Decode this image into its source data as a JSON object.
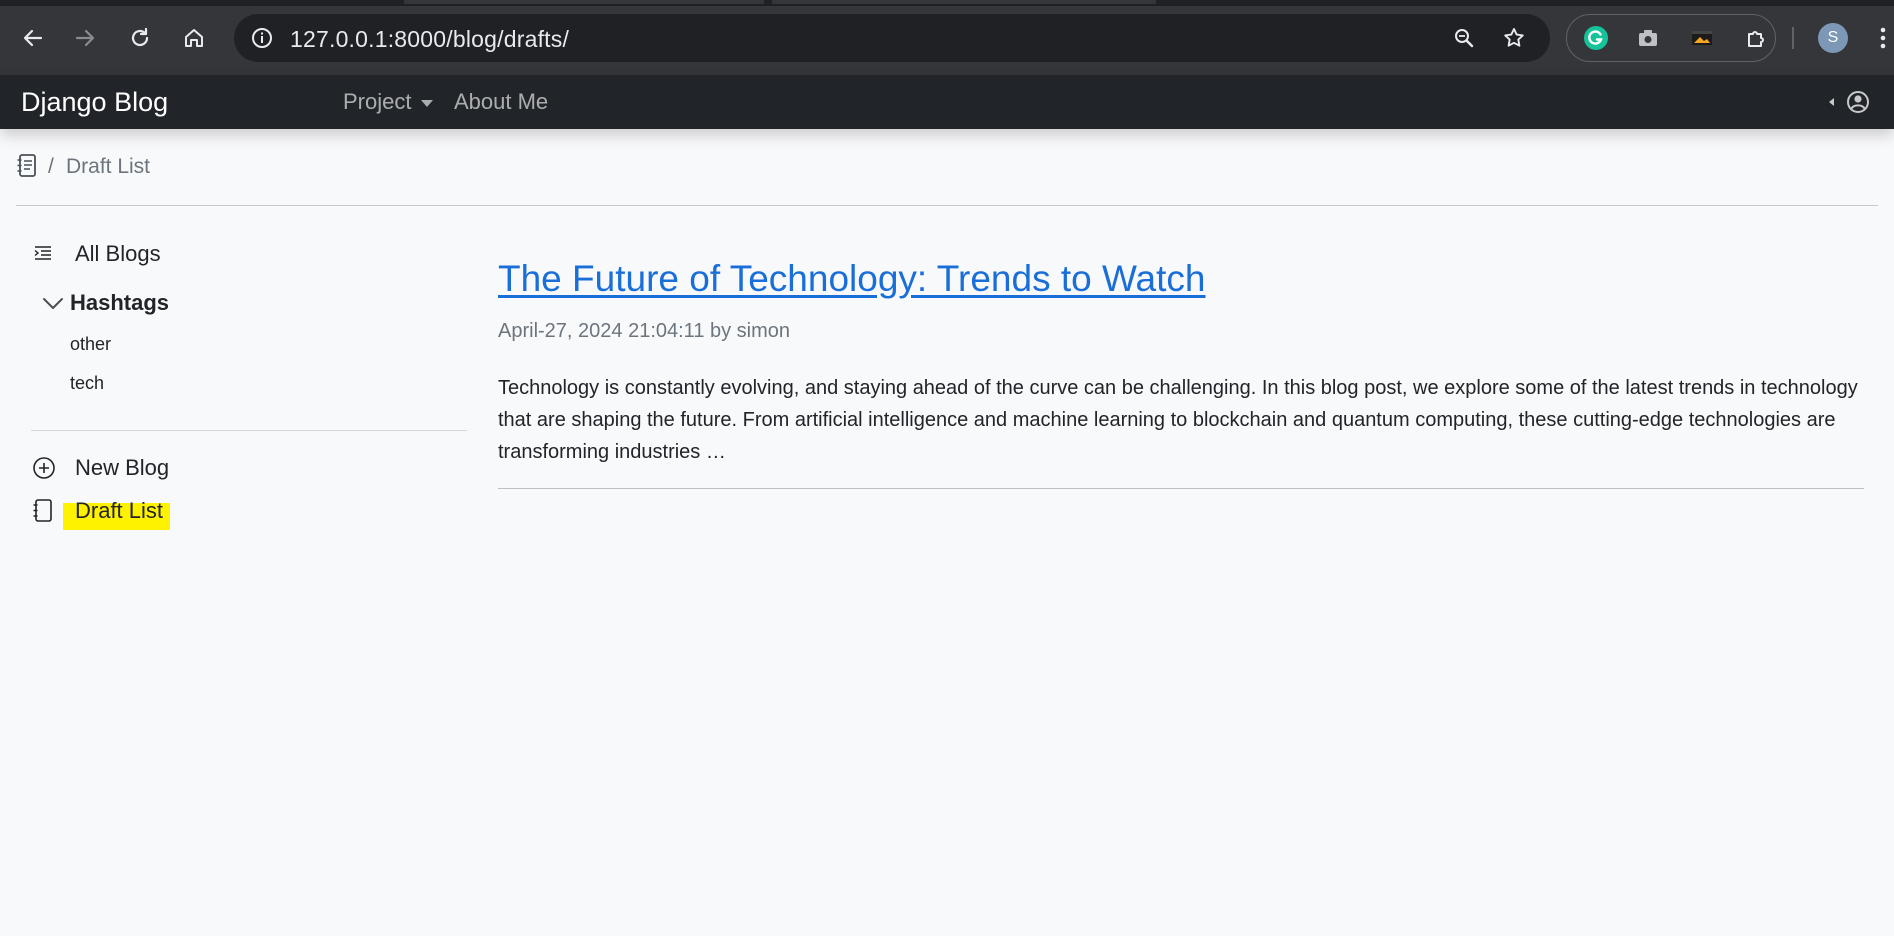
{
  "browser": {
    "url": "127.0.0.1:8000/blog/drafts/",
    "profile_initial": "S"
  },
  "navbar": {
    "brand": "Django Blog",
    "project_label": "Project",
    "about_label": "About Me"
  },
  "breadcrumb": {
    "separator": "/",
    "current": "Draft List"
  },
  "sidebar": {
    "all_blogs": "All Blogs",
    "hashtags_title": "Hashtags",
    "tags": [
      "other",
      "tech"
    ],
    "new_blog": "New Blog",
    "draft_list": "Draft List"
  },
  "post": {
    "title": "The Future of Technology: Trends to Watch",
    "meta": "April-27, 2024 21:04:11 by simon",
    "excerpt": "Technology is constantly evolving, and staying ahead of the curve can be challenging. In this blog post, we explore some of the latest trends in technology that are shaping the future. From artificial intelligence and machine learning to blockchain and quantum computing, these cutting-edge technologies are transforming industries …"
  },
  "colors": {
    "navbar_bg": "#212529",
    "link": "#1a6ed8",
    "highlight": "#fff200"
  }
}
